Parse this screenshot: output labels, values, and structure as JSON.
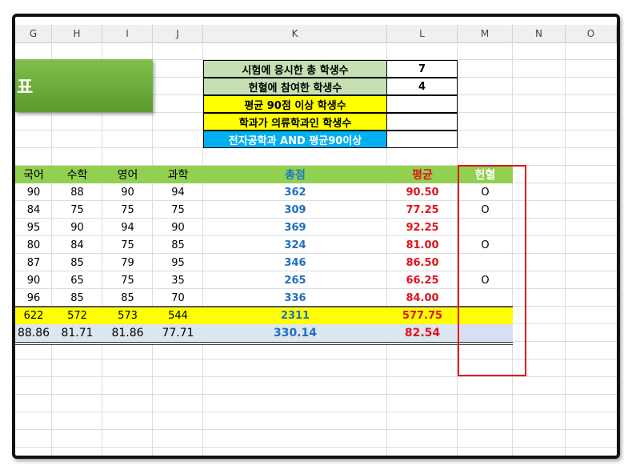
{
  "columns": [
    "G",
    "H",
    "I",
    "J",
    "K",
    "L",
    "M",
    "N",
    "O"
  ],
  "banner_text": "표",
  "info": [
    {
      "label": "시험에 응시한 총 학생수",
      "value": "7",
      "bg": "#c6e0b4",
      "fg": "#000000"
    },
    {
      "label": "헌혈에 참여한 학생수",
      "value": "4",
      "bg": "#c6e0b4",
      "fg": "#000000"
    },
    {
      "label": "평균 90점 이상 학생수",
      "value": "",
      "bg": "#ffff00",
      "fg": "#000000"
    },
    {
      "label": "학과가 의류학과인 학생수",
      "value": "",
      "bg": "#ffff00",
      "fg": "#000000"
    },
    {
      "label": "전자공학과 AND 평균90이상",
      "value": "",
      "bg": "#00b0f0",
      "fg": "#ffffff"
    }
  ],
  "table": {
    "headers": [
      "국어",
      "수학",
      "영어",
      "과학",
      "총점",
      "평균",
      "헌혈"
    ],
    "header_colors": {
      "default": "#000000",
      "total": "#1f77c8",
      "avg": "#e0141e",
      "blood": "#ffffff"
    },
    "header_bg": "#92d050",
    "rows": [
      [
        "90",
        "88",
        "90",
        "94",
        "362",
        "90.50",
        "O"
      ],
      [
        "84",
        "75",
        "75",
        "75",
        "309",
        "77.25",
        "O"
      ],
      [
        "95",
        "90",
        "94",
        "90",
        "369",
        "92.25",
        ""
      ],
      [
        "80",
        "84",
        "75",
        "85",
        "324",
        "81.00",
        "O"
      ],
      [
        "87",
        "85",
        "79",
        "95",
        "346",
        "86.50",
        ""
      ],
      [
        "90",
        "65",
        "75",
        "35",
        "265",
        "66.25",
        "O"
      ],
      [
        "96",
        "85",
        "85",
        "70",
        "336",
        "84.00",
        ""
      ]
    ],
    "sum_row": [
      "622",
      "572",
      "573",
      "544",
      "2311",
      "577.75",
      ""
    ],
    "avg_row": [
      "88.86",
      "81.71",
      "81.86",
      "77.71",
      "330.14",
      "82.54",
      ""
    ],
    "colors": {
      "total": "#1f6fbf",
      "avg": "#e0141e",
      "sum_bg": "#ffff00",
      "avgrow_bg": "#dce6f1",
      "avgrow_m_bg": "#d9dff2"
    }
  }
}
